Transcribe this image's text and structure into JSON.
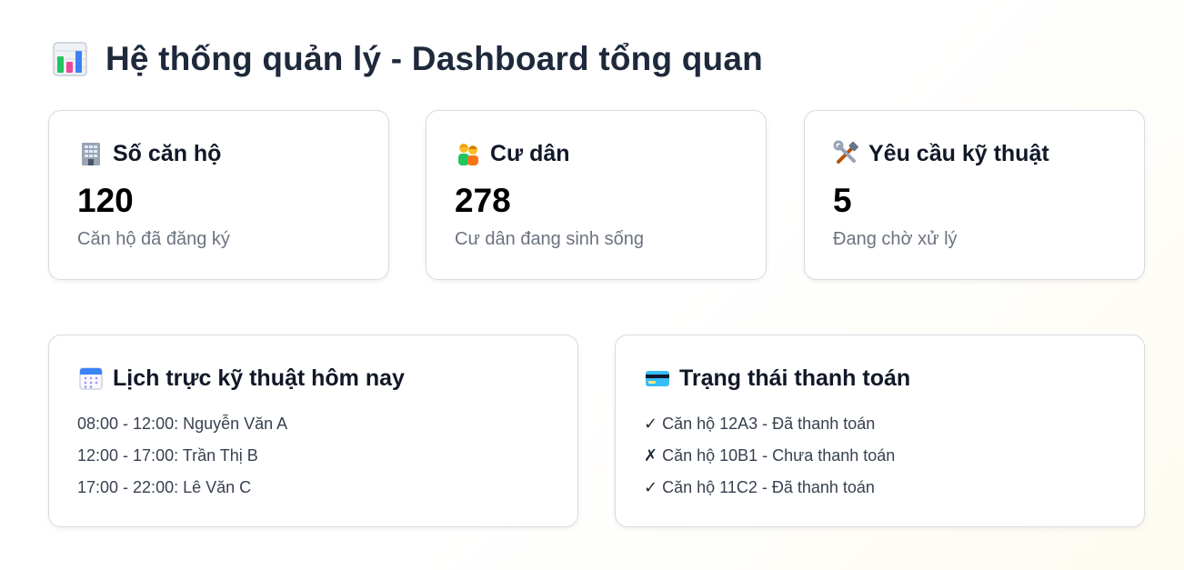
{
  "header": {
    "title": "Hệ thống quản lý - Dashboard tổng quan",
    "icon": "bar-chart-icon"
  },
  "stats": [
    {
      "icon": "building-icon",
      "title": "Số căn hộ",
      "value": "120",
      "description": "Căn hộ đã đăng ký"
    },
    {
      "icon": "people-icon",
      "title": "Cư dân",
      "value": "278",
      "description": "Cư dân đang sinh sống"
    },
    {
      "icon": "tools-icon",
      "title": "Yêu cầu kỹ thuật",
      "value": "5",
      "description": "Đang chờ xử lý"
    }
  ],
  "schedule": {
    "icon": "calendar-icon",
    "title": "Lịch trực kỹ thuật hôm nay",
    "items": [
      "08:00 - 12:00: Nguyễn Văn A",
      "12:00 - 17:00: Trần Thị B",
      "17:00 - 22:00: Lê Văn C"
    ]
  },
  "payments": {
    "icon": "credit-card-icon",
    "title": "Trạng thái thanh toán",
    "items": [
      {
        "mark": "✓",
        "text": "Căn hộ 12A3 - Đã thanh toán"
      },
      {
        "mark": "✗",
        "text": "Căn hộ 10B1 - Chưa thanh toán"
      },
      {
        "mark": "✓",
        "text": "Căn hộ 11C2 - Đã thanh toán"
      }
    ]
  }
}
